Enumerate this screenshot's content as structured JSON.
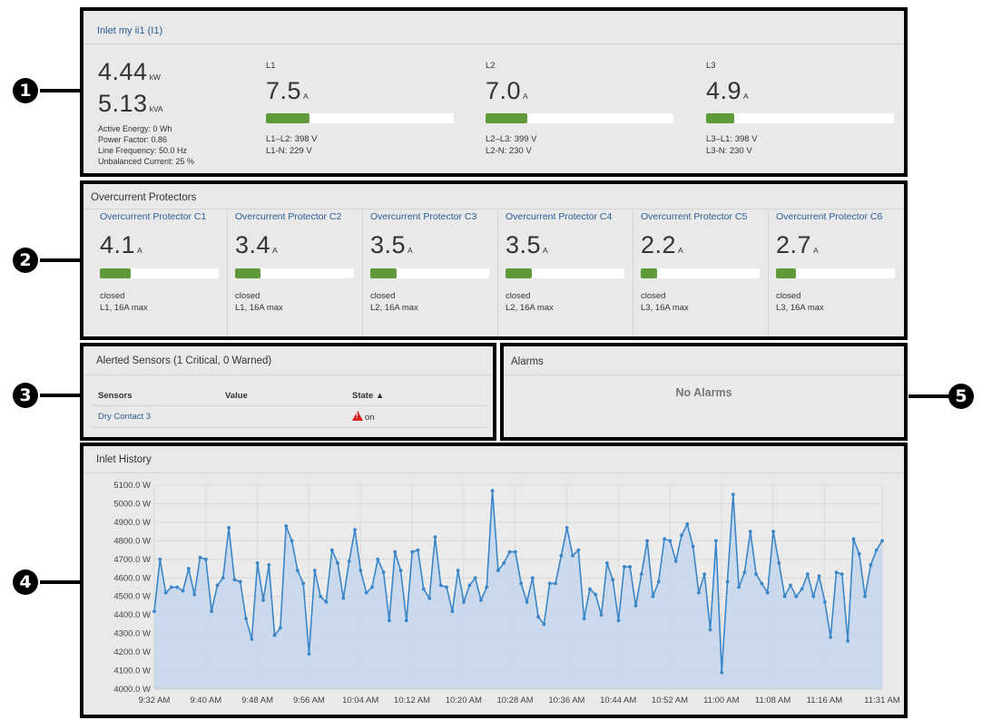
{
  "callouts": [
    "1",
    "2",
    "3",
    "4",
    "5"
  ],
  "inlet": {
    "title": "Inlet my ii1 (I1)",
    "power_value": "4.44",
    "power_unit": "kW",
    "apparent_value": "5.13",
    "apparent_unit": "kVA",
    "active_energy": "Active Energy: 0 Wh",
    "power_factor": "Power Factor: 0.86",
    "line_frequency": "Line Frequency: 50.0 Hz",
    "unbalanced_current": "Unbalanced Current: 25 %",
    "phases": [
      {
        "label": "L1",
        "value": "7.5",
        "unit": "A",
        "fill": 0.23,
        "line1": "L1–L2: 398 V",
        "line2": "L1-N: 229 V"
      },
      {
        "label": "L2",
        "value": "7.0",
        "unit": "A",
        "fill": 0.22,
        "line1": "L2–L3: 399 V",
        "line2": "L2-N: 230 V"
      },
      {
        "label": "L3",
        "value": "4.9",
        "unit": "A",
        "fill": 0.15,
        "line1": "L3–L1: 398 V",
        "line2": "L3-N: 230 V"
      }
    ]
  },
  "ocp": {
    "title": "Overcurrent Protectors",
    "items": [
      {
        "name": "Overcurrent Protector C1",
        "value": "4.1",
        "unit": "A",
        "fill": 0.26,
        "state": "closed",
        "info": "L1, 16A max"
      },
      {
        "name": "Overcurrent Protector C2",
        "value": "3.4",
        "unit": "A",
        "fill": 0.21,
        "state": "closed",
        "info": "L1, 16A max"
      },
      {
        "name": "Overcurrent Protector C3",
        "value": "3.5",
        "unit": "A",
        "fill": 0.22,
        "state": "closed",
        "info": "L2, 16A max"
      },
      {
        "name": "Overcurrent Protector C4",
        "value": "3.5",
        "unit": "A",
        "fill": 0.22,
        "state": "closed",
        "info": "L2, 16A max"
      },
      {
        "name": "Overcurrent Protector C5",
        "value": "2.2",
        "unit": "A",
        "fill": 0.14,
        "state": "closed",
        "info": "L3, 16A max"
      },
      {
        "name": "Overcurrent Protector C6",
        "value": "2.7",
        "unit": "A",
        "fill": 0.17,
        "state": "closed",
        "info": "L3, 16A max"
      }
    ]
  },
  "sensors": {
    "title": "Alerted Sensors (1 Critical, 0 Warned)",
    "columns": [
      "Sensors",
      "Value",
      "State ▲"
    ],
    "rows": [
      {
        "name": "Dry Contact 3",
        "value": "",
        "state": "on"
      }
    ]
  },
  "alarms": {
    "title": "Alarms",
    "empty_text": "No Alarms"
  },
  "history": {
    "title": "Inlet History"
  },
  "colors": {
    "accent_link": "#2a5d92",
    "bar_fill": "#5e9a3a",
    "chart_line": "#3a86c8",
    "chart_area": "#c6d8ec",
    "critical": "#d82020"
  },
  "chart_data": {
    "type": "area",
    "title": "Inlet History",
    "xlabel": "",
    "ylabel": "",
    "ylim": [
      4000,
      5100
    ],
    "yticks": [
      "4000.0 W",
      "4100.0 W",
      "4200.0 W",
      "4300.0 W",
      "4400.0 W",
      "4500.0 W",
      "4600.0 W",
      "4700.0 W",
      "4800.0 W",
      "4900.0 W",
      "5000.0 W",
      "5100.0 W"
    ],
    "xticks": [
      "9:32 AM",
      "9:40 AM",
      "9:48 AM",
      "9:56 AM",
      "10:04 AM",
      "10:12 AM",
      "10:20 AM",
      "10:28 AM",
      "10:36 AM",
      "10:44 AM",
      "10:52 AM",
      "11:00 AM",
      "11:08 AM",
      "11:16 AM",
      "11:31 AM"
    ],
    "grid": true,
    "series": [
      {
        "values": [
          4420,
          4700,
          4520,
          4550,
          4550,
          4530,
          4650,
          4510,
          4710,
          4700,
          4420,
          4560,
          4600,
          4870,
          4590,
          4580,
          4380,
          4270,
          4680,
          4480,
          4670,
          4290,
          4330,
          4880,
          4800,
          4640,
          4570,
          4190,
          4640,
          4500,
          4470,
          4750,
          4680,
          4490,
          4690,
          4860,
          4640,
          4520,
          4550,
          4700,
          4630,
          4370,
          4740,
          4640,
          4370,
          4740,
          4750,
          4540,
          4490,
          4820,
          4560,
          4550,
          4420,
          4640,
          4470,
          4560,
          4600,
          4480,
          4550,
          5070,
          4640,
          4680,
          4740,
          4740,
          4570,
          4470,
          4600,
          4390,
          4350,
          4570,
          4570,
          4720,
          4870,
          4720,
          4750,
          4380,
          4540,
          4510,
          4400,
          4680,
          4590,
          4370,
          4660,
          4660,
          4450,
          4620,
          4800,
          4500,
          4580,
          4810,
          4800,
          4690,
          4830,
          4890,
          4770,
          4520,
          4620,
          4320,
          4800,
          4090,
          4580,
          5050,
          4550,
          4630,
          4850,
          4620,
          4570,
          4520,
          4850,
          4680,
          4500,
          4560,
          4500,
          4540,
          4620,
          4500,
          4610,
          4470,
          4280,
          4630,
          4620,
          4260,
          4810,
          4730,
          4500,
          4670,
          4750,
          4800
        ]
      }
    ]
  }
}
